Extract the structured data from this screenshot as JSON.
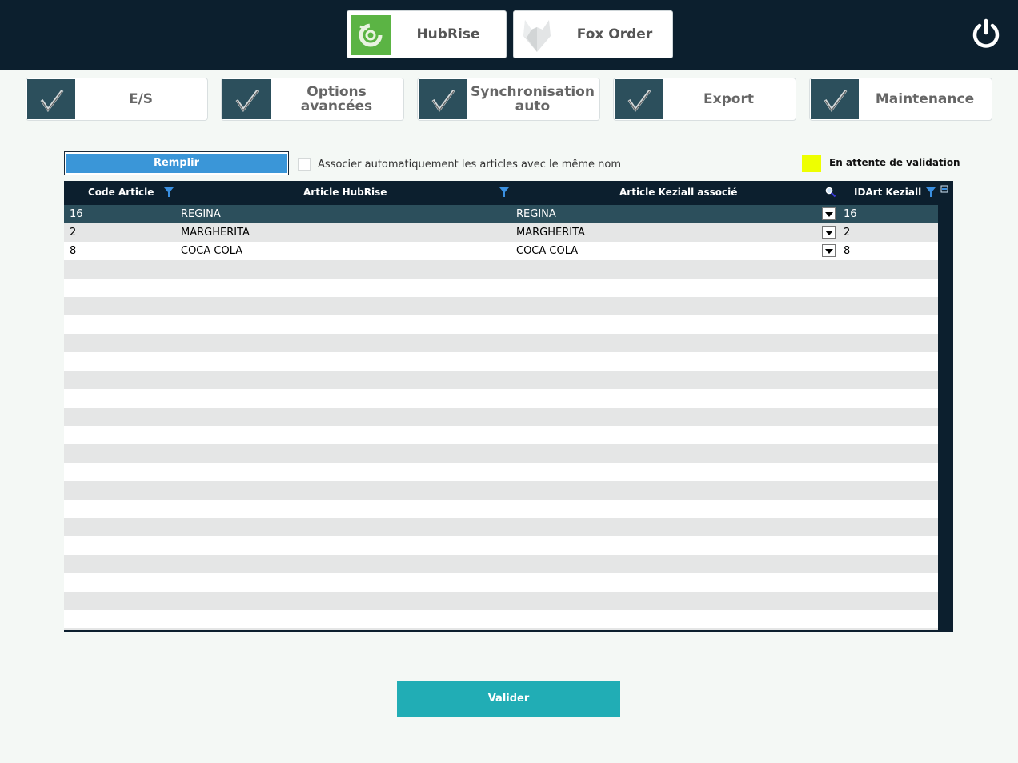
{
  "header": {
    "tabs": [
      {
        "label": "HubRise",
        "icon": "hubrise-logo-icon"
      },
      {
        "label": "Fox Order",
        "icon": "fox-logo-icon"
      }
    ],
    "power_icon": "power-icon"
  },
  "menu": [
    {
      "label": "E/S"
    },
    {
      "label": "Options avancées"
    },
    {
      "label": "Synchronisation auto"
    },
    {
      "label": "Export"
    },
    {
      "label": "Maintenance"
    }
  ],
  "toolbar": {
    "fill_label": "Remplir",
    "auto_associate_label": "Associer automatiquement les articles avec le même nom",
    "auto_associate_checked": false,
    "legend_label": "En attente de validation",
    "legend_color": "#eeff00"
  },
  "table": {
    "columns": [
      "Code Article",
      "Article HubRise",
      "Article Keziall associé",
      "IDArt Keziall"
    ],
    "rows": [
      {
        "code": "16",
        "hubrise": "REGINA",
        "keziall": "REGINA",
        "idart": "16"
      },
      {
        "code": "2",
        "hubrise": "MARGHERITA",
        "keziall": "MARGHERITA",
        "idart": "2"
      },
      {
        "code": "8",
        "hubrise": "COCA COLA",
        "keziall": "COCA COLA",
        "idart": "8"
      }
    ],
    "selected_row": 0
  },
  "validate_label": "Valider",
  "colors": {
    "header_bg": "#0c1f2e",
    "accent_teal": "#21adb5",
    "button_blue": "#3a96d8",
    "selected_row": "#2c4f5c"
  }
}
